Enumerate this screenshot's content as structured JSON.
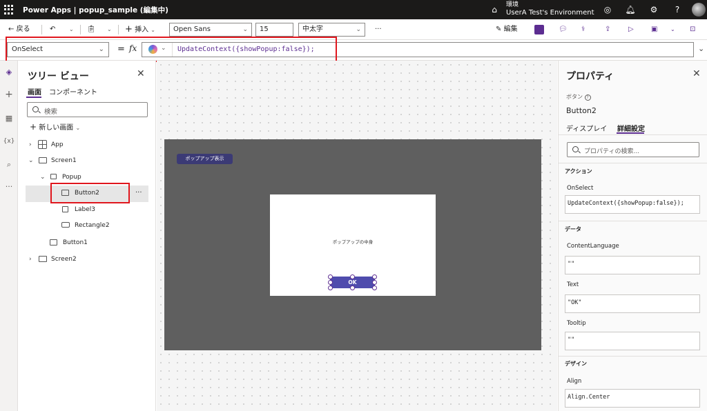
{
  "topbar": {
    "app_title": "Power Apps  |  popup_sample (編集中)",
    "env_label": "環境",
    "env_name": "UserA Test's Environment",
    "help": "?"
  },
  "commandbar": {
    "back": "戻る",
    "insert": "挿入",
    "font_family": "Open Sans",
    "font_size": "15",
    "font_weight": "中太字",
    "more": "···",
    "edit": "編集"
  },
  "formula": {
    "property": "OnSelect",
    "equals": "=",
    "fx": "fx",
    "text": "UpdateContext({showPopup:false});"
  },
  "tree": {
    "title": "ツリー ビュー",
    "tab_screens": "画面",
    "tab_components": "コンポーネント",
    "search_placeholder": "検索",
    "new_screen": "新しい画面",
    "nodes": [
      "App",
      "Screen1",
      "Popup",
      "Button2",
      "Label3",
      "Rectangle2",
      "Button1",
      "Screen2"
    ],
    "more": "···"
  },
  "canvas": {
    "popup_button": "ポップアップ表示",
    "popup_label": "ポップアップの中身",
    "ok_button": "OK"
  },
  "properties": {
    "title": "プロパティ",
    "control_type": "ボタン",
    "control_name": "Button2",
    "tab_display": "ディスプレイ",
    "tab_advanced": "詳細設定",
    "search_placeholder": "プロパティの検索...",
    "section_action": "アクション",
    "onselect_label": "OnSelect",
    "onselect_value": "UpdateContext({showPopup:false});",
    "section_data": "データ",
    "contentlanguage_label": "ContentLanguage",
    "contentlanguage_value": "\"\"",
    "text_label": "Text",
    "text_value": "\"OK\"",
    "tooltip_label": "Tooltip",
    "tooltip_value": "\"\"",
    "section_design": "デザイン",
    "align_label": "Align",
    "align_value": "Align.Center"
  },
  "colors": {
    "accent": "#5c2d91",
    "highlight_red": "#e0161d",
    "button_fill": "#4f4cad",
    "screen_fill": "#5f5f5f"
  }
}
